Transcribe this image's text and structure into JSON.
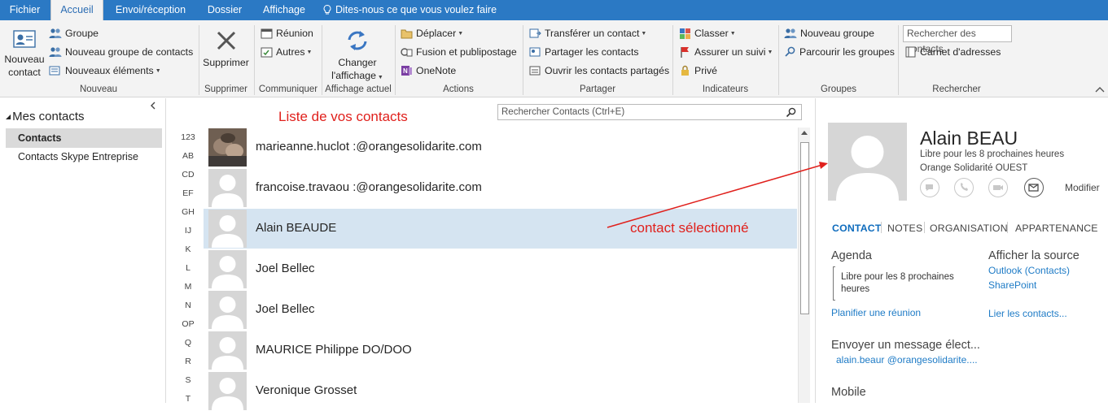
{
  "tabs": [
    {
      "label": "Fichier"
    },
    {
      "label": "Accueil"
    },
    {
      "label": "Envoi/réception"
    },
    {
      "label": "Dossier"
    },
    {
      "label": "Affichage"
    },
    {
      "label": "Dites-nous ce que vous voulez faire"
    }
  ],
  "ribbon": {
    "nouveau": {
      "label_line1": "Nouveau",
      "label_line2": "contact",
      "groupe": "Groupe",
      "nouveau_groupe_contacts": "Nouveau groupe de contacts",
      "nouveaux_elements": "Nouveaux éléments",
      "group_label": "Nouveau"
    },
    "supprimer": {
      "label": "Supprimer",
      "group_label": "Supprimer"
    },
    "communiquer": {
      "reunion": "Réunion",
      "autres": "Autres",
      "group_label": "Communiquer"
    },
    "affichage": {
      "label_line1": "Changer",
      "label_line2": "l'affichage",
      "group_label": "Affichage actuel"
    },
    "actions": {
      "deplacer": "Déplacer",
      "fusion": "Fusion et publipostage",
      "onenote": "OneNote",
      "group_label": "Actions"
    },
    "partager": {
      "transferer": "Transférer un contact",
      "partager": "Partager les contacts",
      "ouvrir": "Ouvrir les contacts partagés",
      "group_label": "Partager"
    },
    "indicateurs": {
      "classer": "Classer",
      "assurer": "Assurer un suivi",
      "prive": "Privé",
      "group_label": "Indicateurs"
    },
    "groupes": {
      "nouveau": "Nouveau groupe",
      "parcourir": "Parcourir les groupes",
      "group_label": "Groupes"
    },
    "rechercher": {
      "search_placeholder": "Rechercher des contacts",
      "carnet": "Carnet d'adresses",
      "group_label": "Rechercher"
    }
  },
  "leftnav": {
    "header": "Mes contacts",
    "items": [
      {
        "label": "Contacts",
        "selected": true
      },
      {
        "label": "Contacts Skype Entreprise",
        "selected": false
      }
    ]
  },
  "list": {
    "search_placeholder": "Rechercher Contacts (Ctrl+E)",
    "annotation": "Liste de vos contacts",
    "alphabet": [
      "123",
      "AB",
      "CD",
      "EF",
      "GH",
      "IJ",
      "K",
      "L",
      "M",
      "N",
      "OP",
      "Q",
      "R",
      "S",
      "T"
    ],
    "contacts": [
      {
        "name": "marieanne.huclot :@orangesolidarite.com",
        "photo": true,
        "selected": false
      },
      {
        "name": "francoise.travaou :@orangesolidarite.com",
        "photo": false,
        "selected": false
      },
      {
        "name": "Alain BEAUDE",
        "photo": false,
        "selected": true
      },
      {
        "name": "Joel Bellec",
        "photo": false,
        "selected": false
      },
      {
        "name": "Joel Bellec",
        "photo": false,
        "selected": false
      },
      {
        "name": "MAURICE Philippe DO/DOO",
        "photo": false,
        "selected": false
      },
      {
        "name": "Veronique Grosset",
        "photo": false,
        "selected": false
      }
    ],
    "selection_annotation": "contact sélectionné"
  },
  "detail": {
    "name": "Alain BEAU",
    "status": "Libre pour les 8 prochaines heures",
    "company": "Orange Solidarité OUEST",
    "modify": "Modifier",
    "tabs": [
      "CONTACT",
      "NOTES",
      "ORGANISATION",
      "APPARTENANCE"
    ],
    "agenda_title": "Agenda",
    "agenda_text_line1": "Libre pour les 8 prochaines",
    "agenda_text_line2": "heures",
    "planifier": "Planifier une réunion",
    "source_title": "Afficher la source",
    "source_outlook": "Outlook (Contacts)",
    "source_sharepoint": "SharePoint",
    "lier": "Lier les contacts...",
    "email_title": "Envoyer un message élect...",
    "email_value": "alain.beaur @orangesolidarite....",
    "mobile_title": "Mobile"
  },
  "colors": {
    "accent": "#2b79c4",
    "annotation": "#e0201c",
    "selection": "#d5e4f1",
    "link": "#1e7bc6"
  }
}
